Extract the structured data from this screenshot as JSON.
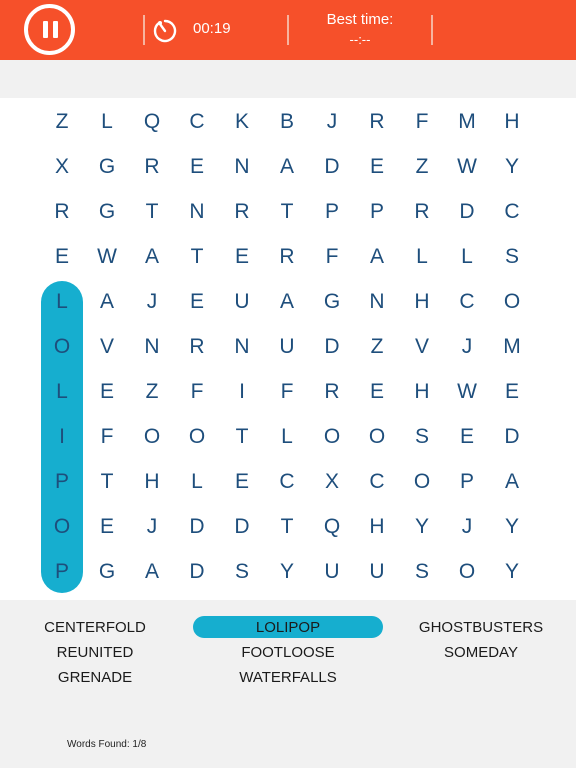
{
  "header": {
    "pause_icon": "pause-icon",
    "timer_icon": "stopwatch-icon",
    "elapsed_time": "00:19",
    "best_time_label": "Best time:",
    "best_time_value": "--:--"
  },
  "colors": {
    "header_bg": "#f6502a",
    "accent": "#16aecf",
    "letter": "#1e4e7c",
    "background": "#f1f1f1"
  },
  "grid": {
    "rows": [
      [
        "Z",
        "L",
        "Q",
        "C",
        "K",
        "B",
        "J",
        "R",
        "F",
        "M",
        "H"
      ],
      [
        "X",
        "G",
        "R",
        "E",
        "N",
        "A",
        "D",
        "E",
        "Z",
        "W",
        "Y"
      ],
      [
        "R",
        "G",
        "T",
        "N",
        "R",
        "T",
        "P",
        "P",
        "R",
        "D",
        "C"
      ],
      [
        "E",
        "W",
        "A",
        "T",
        "E",
        "R",
        "F",
        "A",
        "L",
        "L",
        "S"
      ],
      [
        "L",
        "A",
        "J",
        "E",
        "U",
        "A",
        "G",
        "N",
        "H",
        "C",
        "O"
      ],
      [
        "O",
        "V",
        "N",
        "R",
        "N",
        "U",
        "D",
        "Z",
        "V",
        "J",
        "M"
      ],
      [
        "L",
        "E",
        "Z",
        "F",
        "I",
        "F",
        "R",
        "E",
        "H",
        "W",
        "E"
      ],
      [
        "I",
        "F",
        "O",
        "O",
        "T",
        "L",
        "O",
        "O",
        "S",
        "E",
        "D"
      ],
      [
        "P",
        "T",
        "H",
        "L",
        "E",
        "C",
        "X",
        "C",
        "O",
        "P",
        "A"
      ],
      [
        "O",
        "E",
        "J",
        "D",
        "D",
        "T",
        "Q",
        "H",
        "Y",
        "J",
        "Y"
      ],
      [
        "P",
        "G",
        "A",
        "D",
        "S",
        "Y",
        "U",
        "U",
        "S",
        "O",
        "Y"
      ]
    ],
    "found_highlights": [
      {
        "word": "LOLIPOP",
        "start": [
          4,
          0
        ],
        "end": [
          10,
          0
        ]
      }
    ]
  },
  "word_list": [
    {
      "label": "CENTERFOLD",
      "found": false
    },
    {
      "label": "LOLIPOP",
      "found": true
    },
    {
      "label": "GHOSTBUSTERS",
      "found": false
    },
    {
      "label": "REUNITED",
      "found": false
    },
    {
      "label": "FOOTLOOSE",
      "found": false
    },
    {
      "label": "SOMEDAY",
      "found": false
    },
    {
      "label": "GRENADE",
      "found": false
    },
    {
      "label": "WATERFALLS",
      "found": false
    }
  ],
  "footer": {
    "words_found_text": "Words Found: 1/8"
  }
}
